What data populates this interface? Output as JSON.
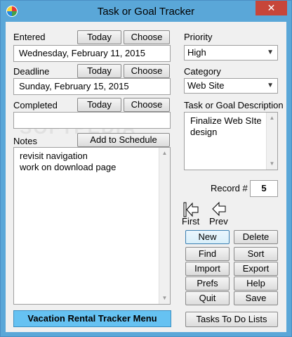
{
  "window": {
    "title": "Task or Goal Tracker",
    "close_glyph": "✕"
  },
  "entered": {
    "label": "Entered",
    "today_label": "Today",
    "choose_label": "Choose",
    "value": "Wednesday, February 11, 2015"
  },
  "deadline": {
    "label": "Deadline",
    "today_label": "Today",
    "choose_label": "Choose",
    "value": "Sunday, February 15, 2015"
  },
  "completed": {
    "label": "Completed",
    "today_label": "Today",
    "choose_label": "Choose",
    "value": ""
  },
  "notes": {
    "label": "Notes",
    "add_schedule_label": "Add to Schedule",
    "lines": [
      "revisit navigation",
      "work on download page"
    ]
  },
  "priority": {
    "label": "Priority",
    "value": "High"
  },
  "category": {
    "label": "Category",
    "value": "Web Site"
  },
  "description": {
    "label": "Task or Goal Description",
    "lines": [
      "Finalize Web SIte",
      "design"
    ]
  },
  "record": {
    "label": "Record #",
    "value": "5"
  },
  "nav": {
    "first_label": "First",
    "prev_label": "Prev"
  },
  "actions": {
    "new": "New",
    "delete": "Delete",
    "find": "Find",
    "sort": "Sort",
    "import": "Import",
    "export": "Export",
    "prefs": "Prefs",
    "help": "Help",
    "quit": "Quit",
    "save": "Save"
  },
  "footer": {
    "menu_label": "Vacation Rental Tracker Menu",
    "tasks_label": "Tasks To Do Lists"
  },
  "watermark": "SOFTPEDIA"
}
